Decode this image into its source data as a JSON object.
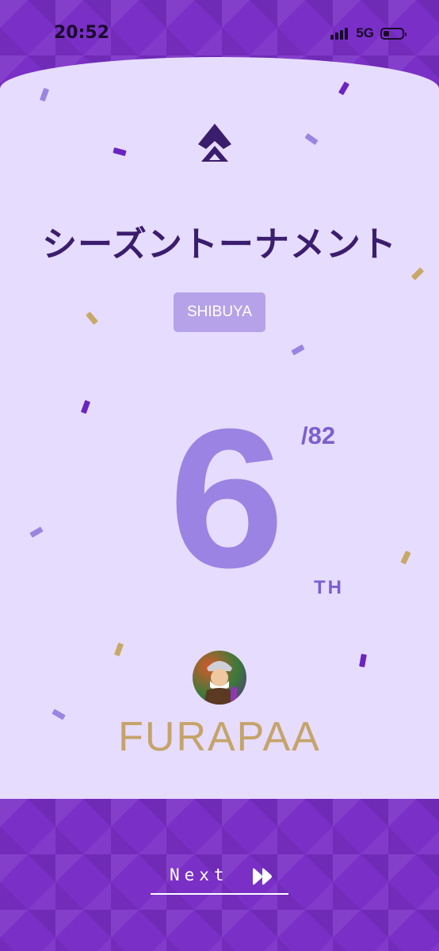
{
  "status_bar": {
    "time": "20:52",
    "network": "5G",
    "signal_bars": 4,
    "battery_level": 0.3
  },
  "tournament": {
    "title": "シーズントーナメント",
    "location": "SHIBUYA"
  },
  "result": {
    "rank": "6",
    "total": "/82",
    "suffix": "TH"
  },
  "player": {
    "name": "FURAPAA",
    "avatar_icon": "player-avatar"
  },
  "footer": {
    "next_label": "Next",
    "next_icon": "fast-forward-icon"
  },
  "colors": {
    "band_purple": "#7a2fc6",
    "card_lavender": "#e6dcfd",
    "title_purple": "#3b1d6e",
    "rank_purple": "#9b83e3",
    "gold": "#c5a36a"
  }
}
